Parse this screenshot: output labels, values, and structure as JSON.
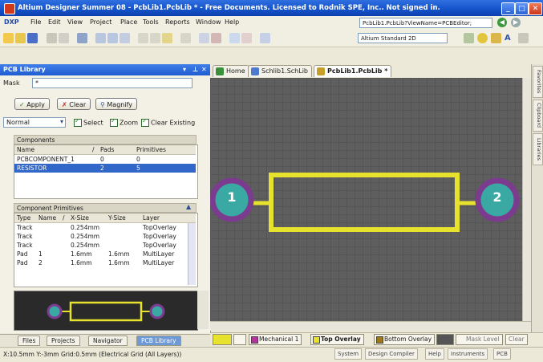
{
  "window": {
    "title": "Altium Designer Summer 08 - PcbLib1.PcbLib * - Free Documents. Licensed to Rodnik SPE, Inc.. Not signed in.",
    "buttons": {
      "minimize": "_",
      "maximize": "□",
      "close": "✕"
    }
  },
  "menu": {
    "items": [
      "DXP",
      "File",
      "Edit",
      "View",
      "Project",
      "Place",
      "Tools",
      "Reports",
      "Window",
      "Help"
    ],
    "path": "PcbLib1.PcbLib?ViewName=PCBEditor;",
    "back": "◀",
    "forward": "▶"
  },
  "toolbar": {
    "view_mode": "Altium Standard 2D"
  },
  "panel": {
    "title": "PCB Library",
    "mask_label": "Mask",
    "mask_value": "*",
    "apply": "Apply",
    "clear": "Clear",
    "magnify": "Magnify",
    "mode": "Normal",
    "checks": [
      "Select",
      "Zoom",
      "Clear Existing"
    ],
    "components": {
      "heading": "Components",
      "columns": [
        "Name",
        "/",
        "Pads",
        "Primitives"
      ],
      "rows": [
        {
          "name": "PCBCOMPONENT_1",
          "pads": "0",
          "prims": "0"
        },
        {
          "name": "RESISTOR",
          "pads": "2",
          "prims": "5"
        }
      ]
    },
    "primitives": {
      "heading": "Component Primitives",
      "columns": [
        "Type",
        "Name",
        "/",
        "X-Size",
        "Y-Size",
        "Layer"
      ],
      "rows": [
        {
          "type": "Track",
          "name": "",
          "x": "0.254mm",
          "y": "",
          "layer": "TopOverlay"
        },
        {
          "type": "Track",
          "name": "",
          "x": "0.254mm",
          "y": "",
          "layer": "TopOverlay"
        },
        {
          "type": "Track",
          "name": "",
          "x": "0.254mm",
          "y": "",
          "layer": "TopOverlay"
        },
        {
          "type": "Pad",
          "name": "1",
          "x": "1.6mm",
          "y": "1.6mm",
          "layer": "MultiLayer"
        },
        {
          "type": "Pad",
          "name": "2",
          "x": "1.6mm",
          "y": "1.6mm",
          "layer": "MultiLayer"
        }
      ]
    },
    "tabs": [
      "Files",
      "Projects",
      "Navigator",
      "PCB Library"
    ]
  },
  "documents": {
    "tabs": [
      "Home",
      "Schlib1.SchLib",
      "PcbLib1.PcbLib *"
    ]
  },
  "canvas": {
    "pad1_label": "1",
    "pad2_label": "2"
  },
  "side_tabs": [
    "Favorites",
    "Clipboard",
    "Libraries"
  ],
  "layers": {
    "tabs": [
      "Mechanical 1",
      "Top Overlay",
      "Bottom Overlay",
      "Mask Level",
      "Clear"
    ]
  },
  "status": {
    "coords": "X:10.5mm Y:-3mm   Grid:0.5mm   (Electrical Grid (All Layers))",
    "items": [
      "System",
      "Design Compiler",
      "Help",
      "Instruments",
      "PCB"
    ]
  },
  "colors": {
    "overlay": "#e6e22e",
    "pad_ring": "#7b3c8f",
    "pad_core": "#3aa9a3"
  }
}
